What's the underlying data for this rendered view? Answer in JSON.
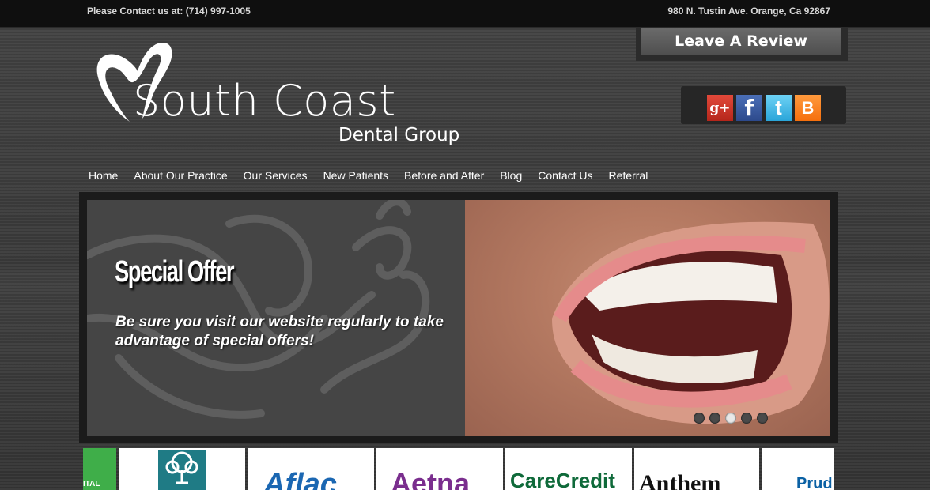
{
  "topbar": {
    "phone": "Please Contact us at: (714) 997-1005",
    "address": "980 N. Tustin Ave. Orange, Ca 92867"
  },
  "review": {
    "label": "Leave A Review"
  },
  "logo": {
    "main": "South Coast",
    "sub": "Dental Group"
  },
  "social": [
    {
      "icon": "google-plus-icon",
      "glyph": "g+"
    },
    {
      "icon": "facebook-icon",
      "glyph": "f"
    },
    {
      "icon": "twitter-icon",
      "glyph": "t"
    },
    {
      "icon": "blogger-icon",
      "glyph": "B"
    }
  ],
  "nav": [
    "Home",
    "About Our Practice",
    "Our Services",
    "New Patients",
    "Before and After",
    "Blog",
    "Contact Us",
    "Referral"
  ],
  "slider": {
    "title": "Special Offer",
    "text": "Be sure you visit our website regularly to take advantage of special offers!",
    "dot_count": 5,
    "active_dot": 3
  },
  "insurance": {
    "partial_left": "ITAL",
    "aflac": "Aflac",
    "aetna": "Aetna",
    "carecredit": "CareCredit",
    "anthem": "Anthem",
    "prudential": "Prud"
  },
  "colors": {
    "topbar": "#0f0f0f",
    "green_tile": "#3fae49",
    "teal_logo": "#1f7b85",
    "aflac_blue": "#1b67b2",
    "aetna_purple": "#7a2e8e",
    "carecredit_green": "#0f6a3a",
    "anthem_blue": "#0b61a4"
  }
}
